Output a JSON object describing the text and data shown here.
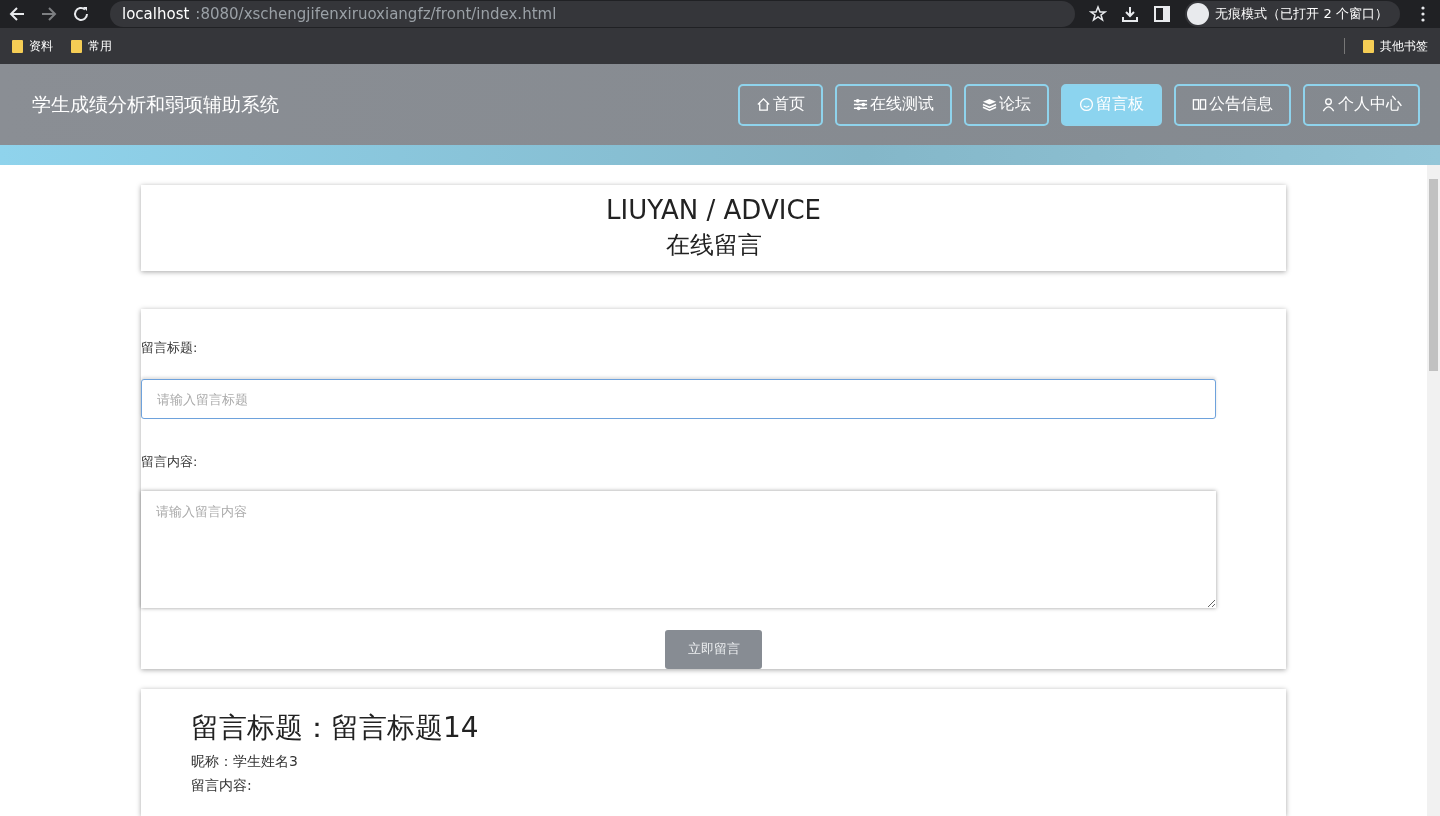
{
  "browser": {
    "url_host": "localhost",
    "url_path": ":8080/xschengjifenxiruoxiangfz/front/index.html",
    "profile": "无痕模式（已打开 2 个窗口）",
    "bookmarks": [
      "资料",
      "常用"
    ],
    "other_bookmarks": "其他书签"
  },
  "header": {
    "title": "学生成绩分析和弱项辅助系统",
    "nav": [
      {
        "label": "首页",
        "kind": "home",
        "selected": false
      },
      {
        "label": "在线测试",
        "kind": "sliders",
        "selected": false
      },
      {
        "label": "论坛",
        "kind": "layers",
        "selected": false
      },
      {
        "label": "留言板",
        "kind": "smile",
        "selected": true
      },
      {
        "label": "公告信息",
        "kind": "book",
        "selected": false
      },
      {
        "label": "个人中心",
        "kind": "user",
        "selected": false
      }
    ]
  },
  "banner": {
    "title": "LIUYAN / ADVICE",
    "subtitle": "在线留言"
  },
  "form": {
    "title_label": "留言标题:",
    "title_placeholder": "请输入留言标题",
    "content_label": "留言内容:",
    "content_placeholder": "请输入留言内容",
    "submit": "立即留言"
  },
  "messages": [
    {
      "title": "留言标题：留言标题14",
      "nickname": "昵称：学生姓名3",
      "content_label": "留言内容:"
    }
  ]
}
